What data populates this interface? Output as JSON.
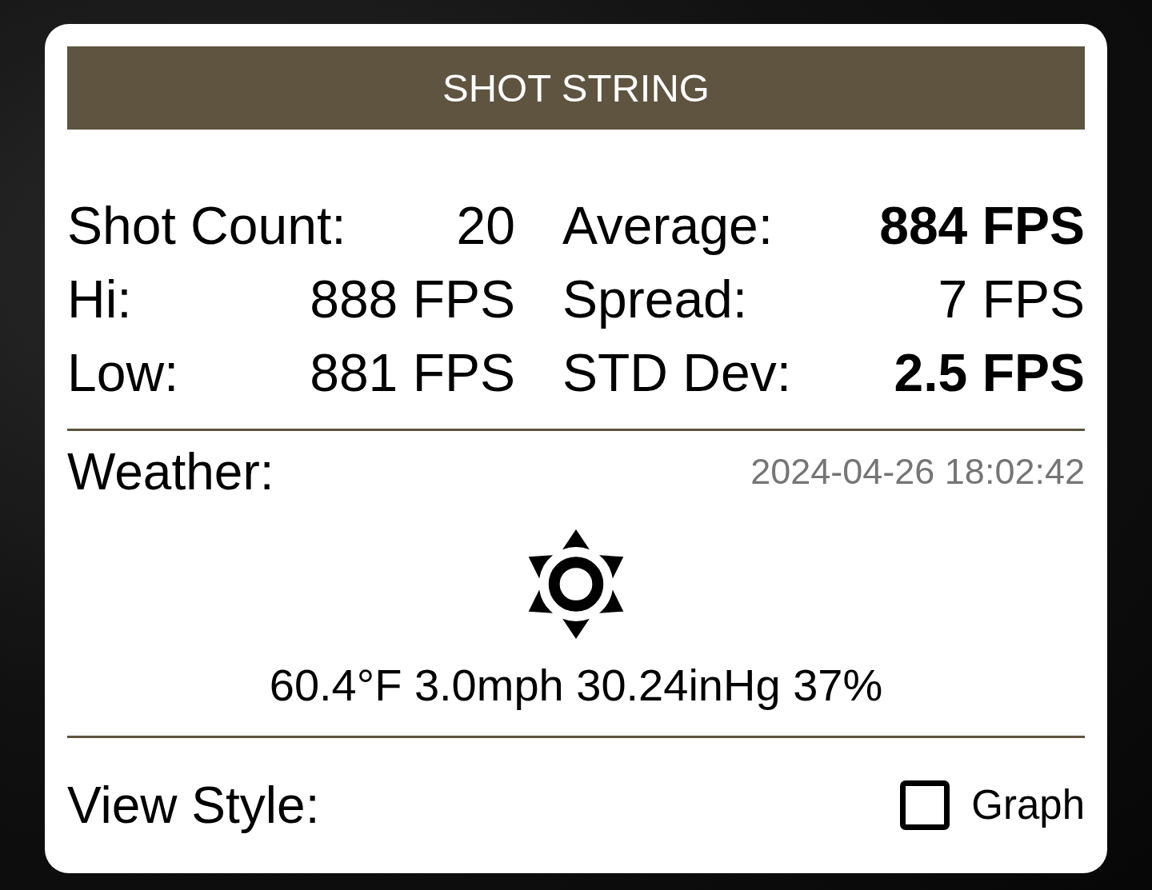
{
  "header": {
    "title": "SHOT STRING"
  },
  "stats": [
    {
      "label": "Shot Count:",
      "value": "20",
      "bold": false
    },
    {
      "label": "Average:",
      "value": "884 FPS",
      "bold": true
    },
    {
      "label": "Hi:",
      "value": "888 FPS",
      "bold": false
    },
    {
      "label": "Spread:",
      "value": "7 FPS",
      "bold": false
    },
    {
      "label": "Low:",
      "value": "881 FPS",
      "bold": false
    },
    {
      "label": "STD Dev:",
      "value": "2.5 FPS",
      "bold": true
    }
  ],
  "weather": {
    "label": "Weather:",
    "timestamp": "2024-04-26 18:02:42",
    "conditions": "60.4°F 3.0mph 30.24inHg 37%"
  },
  "view_style": {
    "label": "View Style:",
    "option": "Graph",
    "checked": false
  }
}
